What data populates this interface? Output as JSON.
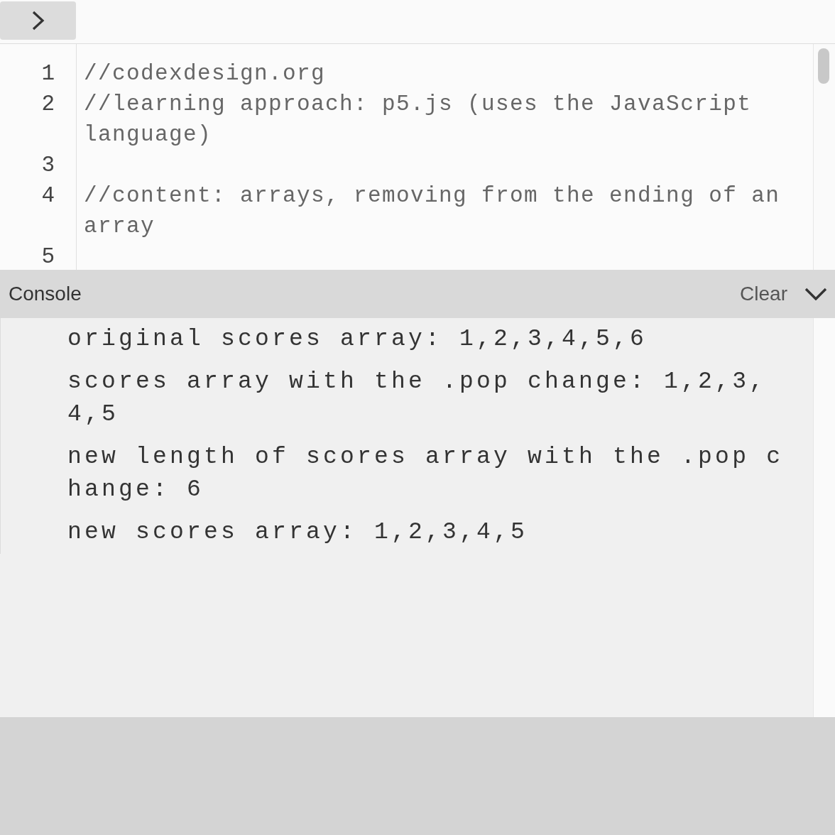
{
  "editor": {
    "lines": [
      {
        "number": "1",
        "code": "//codexdesign.org"
      },
      {
        "number": "2",
        "code": "//learning approach: p5.js (uses the JavaScript language)"
      },
      {
        "number": "3"
      },
      {
        "number": "4",
        "code": "//content: arrays, removing from the ending of an array"
      },
      {
        "number": "5"
      }
    ]
  },
  "console": {
    "title": "Console",
    "clear_label": "Clear",
    "messages": [
      {
        "lines": [
          "original scores array: 1,2,3,4,5,6"
        ]
      },
      {
        "lines": [
          "scores array with the .pop change: 1,2,3,",
          "4,5"
        ]
      },
      {
        "lines": [
          "new length of scores array with the .pop c",
          "hange: 6"
        ]
      },
      {
        "lines": [
          "new scores array: 1,2,3,4,5"
        ]
      }
    ]
  }
}
